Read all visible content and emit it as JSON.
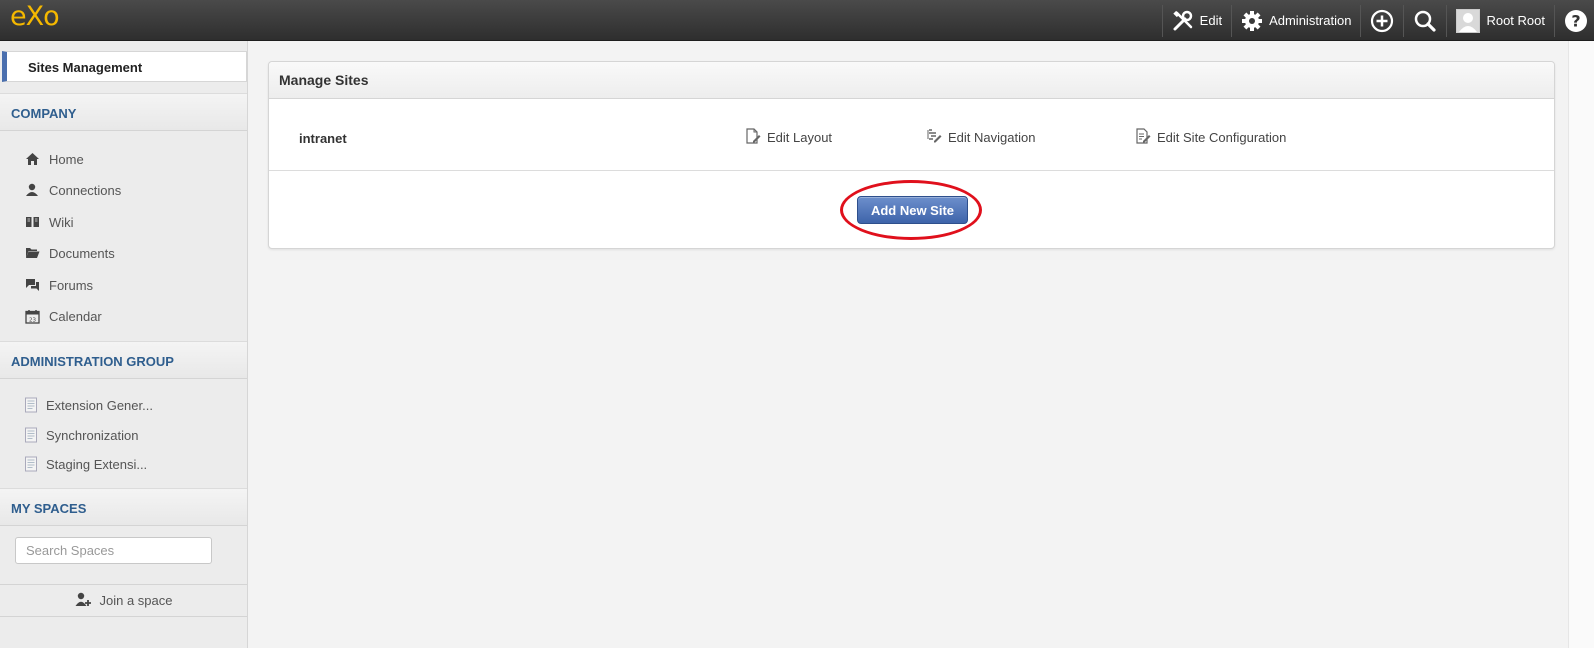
{
  "topbar": {
    "logo_text": "eXo",
    "edit_label": "Edit",
    "administration_label": "Administration",
    "user_name": "Root Root"
  },
  "sidebar": {
    "sites_management_label": "Sites Management",
    "company_heading": "COMPANY",
    "company_items": [
      {
        "label": "Home",
        "icon": "home-icon"
      },
      {
        "label": "Connections",
        "icon": "user-icon"
      },
      {
        "label": "Wiki",
        "icon": "book-icon"
      },
      {
        "label": "Documents",
        "icon": "folder-icon"
      },
      {
        "label": "Forums",
        "icon": "chat-icon"
      },
      {
        "label": "Calendar",
        "icon": "calendar-icon"
      }
    ],
    "admin_heading": "ADMINISTRATION GROUP",
    "admin_items": [
      {
        "label": "Extension Gener...",
        "icon": "page-icon"
      },
      {
        "label": "Synchronization",
        "icon": "page-icon"
      },
      {
        "label": "Staging Extensi...",
        "icon": "page-icon"
      }
    ],
    "spaces_heading": "MY SPACES",
    "search_placeholder": "Search Spaces",
    "join_label": "Join a space"
  },
  "main": {
    "panel_title": "Manage Sites",
    "site": {
      "name": "intranet",
      "edit_layout_label": "Edit Layout",
      "edit_navigation_label": "Edit Navigation",
      "edit_config_label": "Edit Site Configuration"
    },
    "add_new_site_label": "Add New Site"
  },
  "colors": {
    "accent": "#4a6fae",
    "logo": "#f5b800",
    "highlight": "#e0101c",
    "heading": "#2f5e8e"
  }
}
